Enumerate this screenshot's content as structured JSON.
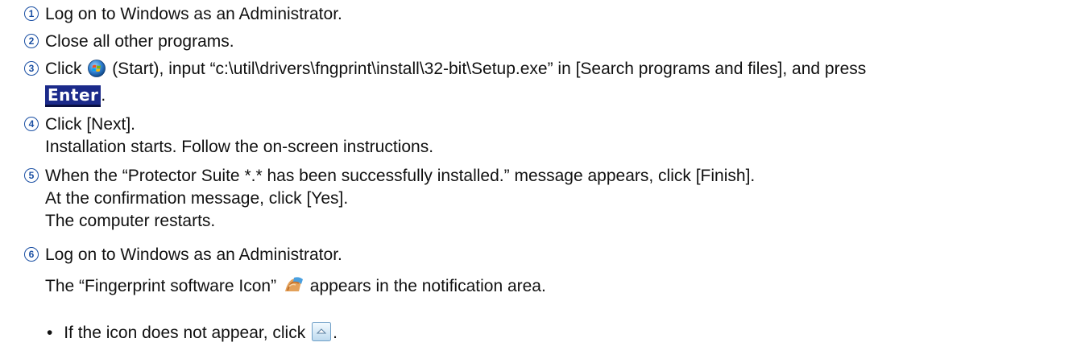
{
  "steps": [
    {
      "num": "1",
      "text": "Log on to Windows as an Administrator."
    },
    {
      "num": "2",
      "text": "Close all other programs."
    },
    {
      "num": "3",
      "text_a": "Click",
      "start_icon": "windows-start-orb-icon",
      "text_b": "(Start), input “c:\\util\\drivers\\fngprint\\install\\32-bit\\Setup.exe” in [Search programs and files], and press",
      "key": "Enter",
      "text_c": "."
    },
    {
      "num": "4",
      "text": "Click [Next].",
      "sub": "Installation starts. Follow the on-screen instructions."
    },
    {
      "num": "5",
      "text": "When the “Protector Suite *.* has been successfully installed.” message appears, click [Finish].",
      "sub1": "At the confirmation message, click [Yes].",
      "sub2": "The computer restarts."
    },
    {
      "num": "6",
      "text": "Log on to Windows as an Administrator.",
      "sub_a": "The “Fingerprint software Icon”",
      "fingerprint_icon": "fingerprint-software-icon",
      "sub_b": "appears in the notification area.",
      "bullet": "•",
      "bullet_a": "If the icon does not appear, click",
      "tray_icon": "show-hidden-icons-button",
      "bullet_b": "."
    }
  ],
  "colors": {
    "step_number": "#1a4fa3",
    "key_bg": "#1b2a8a"
  }
}
